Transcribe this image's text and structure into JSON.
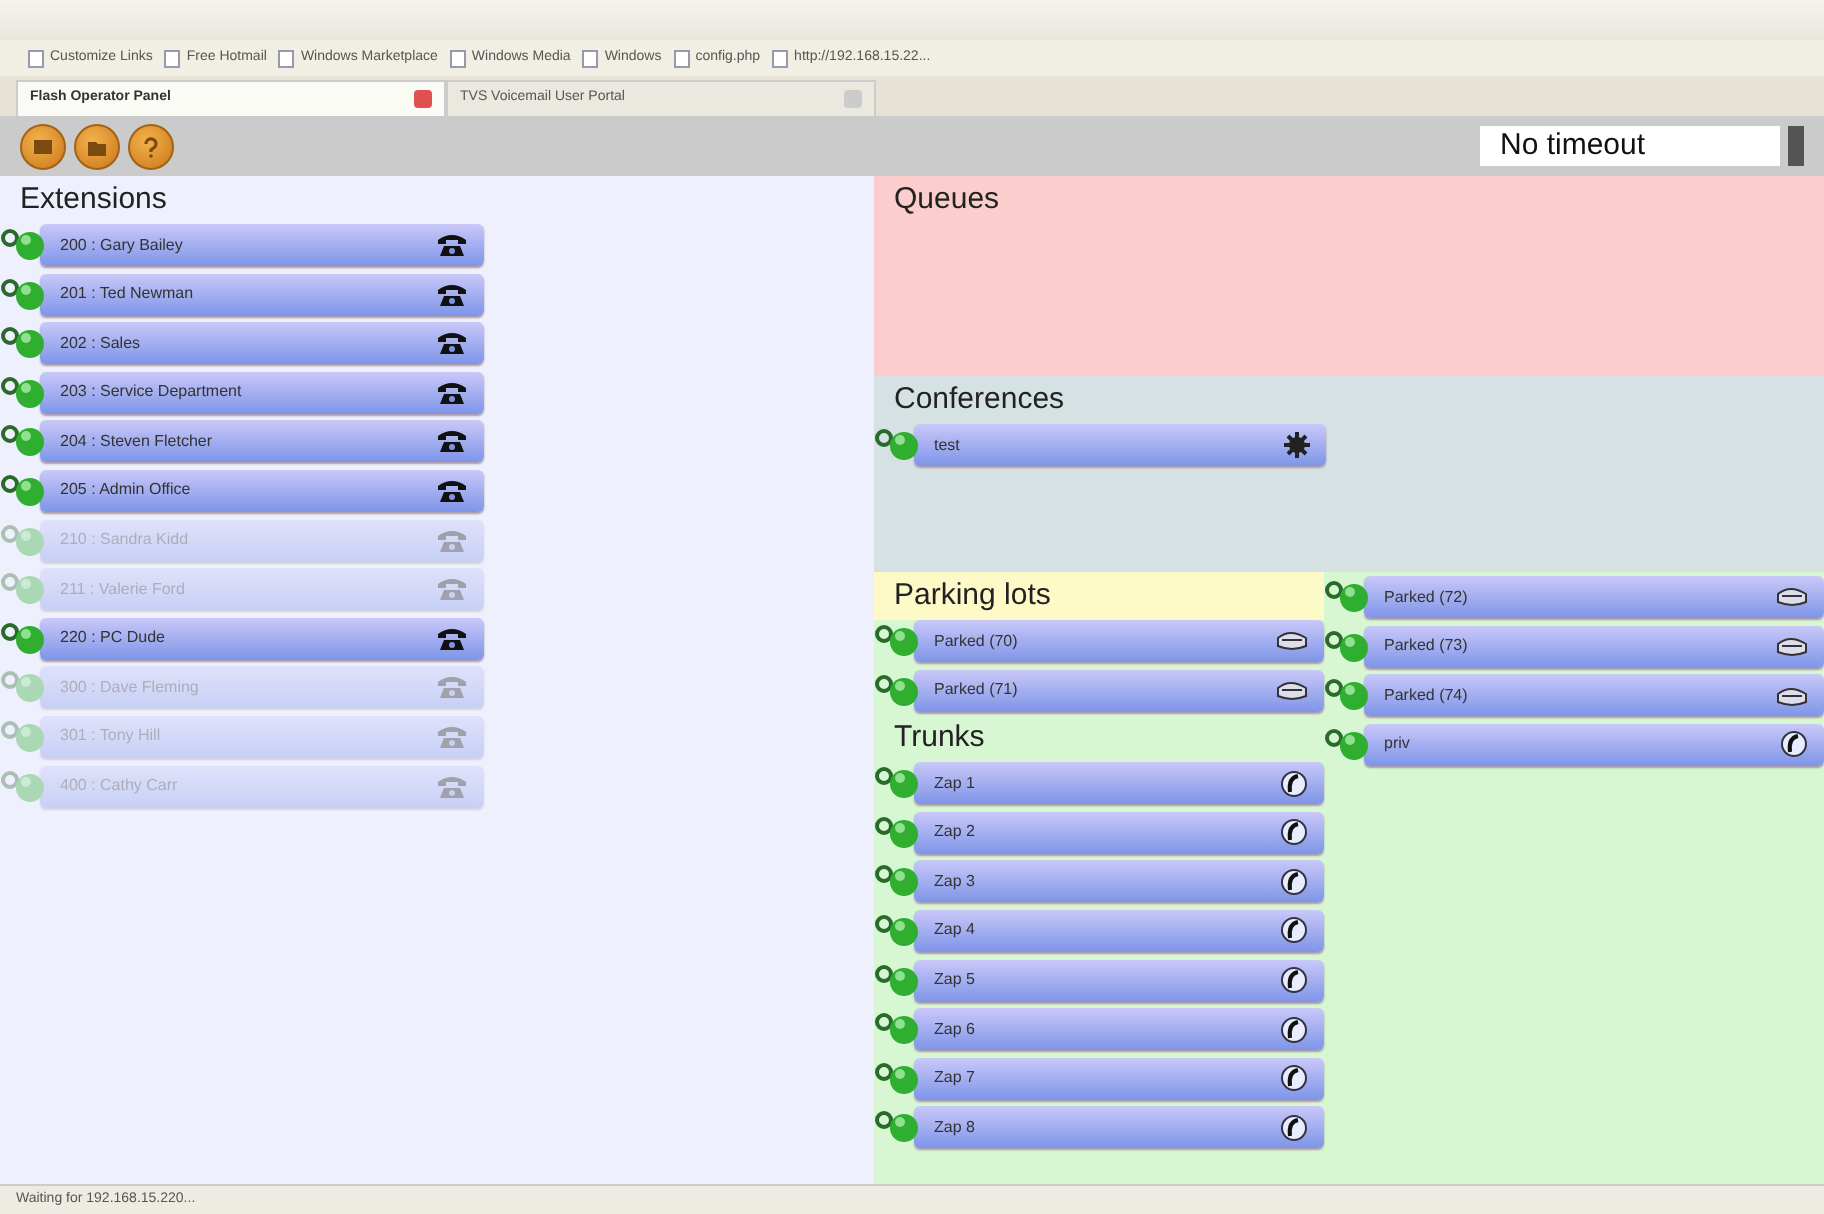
{
  "bookmarks": [
    "Customize Links",
    "Free Hotmail",
    "Windows Marketplace",
    "Windows Media",
    "Windows",
    "config.php",
    "http://192.168.15.22..."
  ],
  "tabs": [
    {
      "label": "Flash Operator Panel",
      "selected": true
    },
    {
      "label": "TVS Voicemail User Portal",
      "selected": false
    }
  ],
  "timeout_field": {
    "value": "No timeout"
  },
  "extensions": {
    "title": "Extensions",
    "items": [
      {
        "label": "200 : Gary Bailey",
        "online": true
      },
      {
        "label": "201 : Ted Newman",
        "online": true
      },
      {
        "label": "202 : Sales",
        "online": true
      },
      {
        "label": "203 : Service Department",
        "online": true
      },
      {
        "label": "204 : Steven Fletcher",
        "online": true
      },
      {
        "label": "205 : Admin Office",
        "online": true
      },
      {
        "label": "210 : Sandra Kidd",
        "online": false
      },
      {
        "label": "211 : Valerie Ford",
        "online": false
      },
      {
        "label": "220 : PC Dude",
        "online": true
      },
      {
        "label": "300 : Dave Fleming",
        "online": false
      },
      {
        "label": "301 : Tony Hill",
        "online": false
      },
      {
        "label": "400 : Cathy Carr",
        "online": false
      }
    ]
  },
  "queues": {
    "title": "Queues"
  },
  "conferences": {
    "title": "Conferences",
    "items": [
      {
        "label": "test",
        "kind": "conference"
      }
    ]
  },
  "parking": {
    "title": "Parking lots",
    "items": [
      {
        "label": "Parked (70)",
        "kind": "parked"
      },
      {
        "label": "Parked (71)",
        "kind": "parked"
      },
      {
        "label": "Parked (72)",
        "kind": "parked"
      },
      {
        "label": "Parked (73)",
        "kind": "parked"
      },
      {
        "label": "Parked (74)",
        "kind": "parked"
      },
      {
        "label": "priv",
        "kind": "trunk"
      }
    ]
  },
  "trunks": {
    "title": "Trunks",
    "items": [
      {
        "label": "Zap 1",
        "kind": "trunk"
      },
      {
        "label": "Zap 2",
        "kind": "trunk"
      },
      {
        "label": "Zap 3",
        "kind": "trunk"
      },
      {
        "label": "Zap 4",
        "kind": "trunk"
      },
      {
        "label": "Zap 5",
        "kind": "trunk"
      },
      {
        "label": "Zap 6",
        "kind": "trunk"
      },
      {
        "label": "Zap 7",
        "kind": "trunk"
      },
      {
        "label": "Zap 8",
        "kind": "trunk"
      }
    ]
  },
  "status_bar": "Waiting for 192.168.15.220..."
}
